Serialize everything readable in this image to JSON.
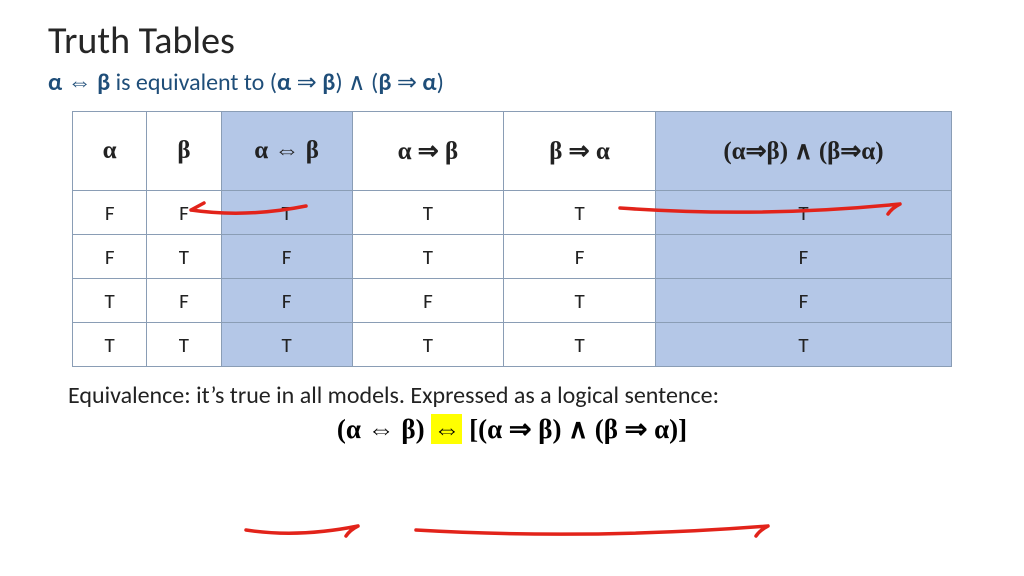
{
  "title": "Truth Tables",
  "subtitle_parts": {
    "alpha": "α",
    "iff": "⇔",
    "beta": "β",
    "text": " is equivalent to ",
    "lp": "(",
    "imp": "⇒",
    "rp": ")",
    "and": "∧"
  },
  "table": {
    "headers": {
      "h1": "α",
      "h2": "β",
      "h3": "α ⇔ β",
      "h4": "α ⇒ β",
      "h5": "β ⇒ α",
      "h6": "(α⇒β) ∧ (β⇒α)"
    },
    "rows": [
      {
        "c1": "F",
        "c2": "F",
        "c3": "T",
        "c4": "T",
        "c5": "T",
        "c6": "T"
      },
      {
        "c1": "F",
        "c2": "T",
        "c3": "F",
        "c4": "T",
        "c5": "F",
        "c6": "F"
      },
      {
        "c1": "T",
        "c2": "F",
        "c3": "F",
        "c4": "F",
        "c5": "T",
        "c6": "F"
      },
      {
        "c1": "T",
        "c2": "T",
        "c3": "T",
        "c4": "T",
        "c5": "T",
        "c6": "T"
      }
    ]
  },
  "equiv_text": "Equivalence: it’s true in all models. Expressed as a logical sentence:",
  "formula": {
    "left": "(α ⇔ β)",
    "mid": "⇔",
    "right": "[(α ⇒ β) ∧ (β ⇒ α)]"
  }
}
